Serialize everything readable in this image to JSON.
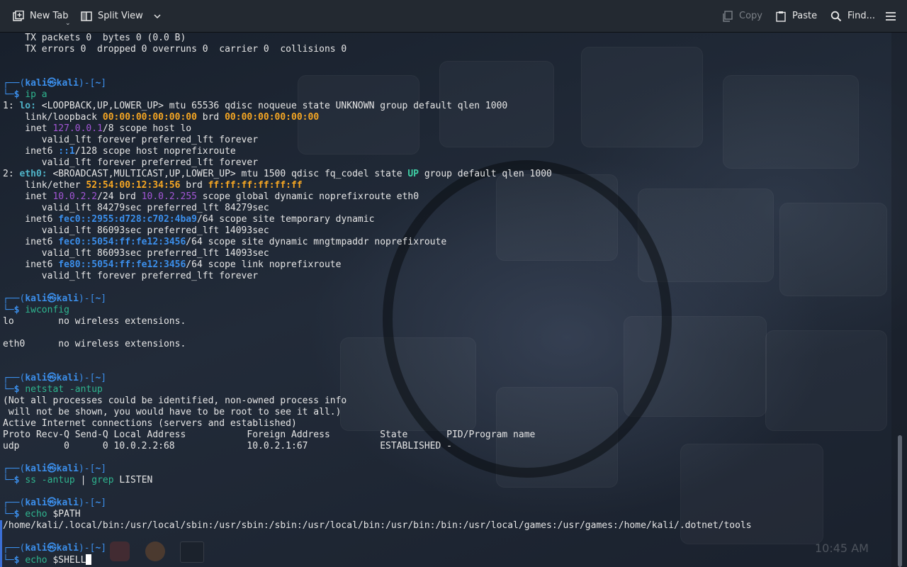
{
  "toolbar": {
    "new_tab": "New Tab",
    "split_view": "Split View",
    "copy": "Copy",
    "paste": "Paste",
    "find": "Find..."
  },
  "prompt": {
    "left": "┌──(",
    "user": "kali",
    "at": "㉿",
    "host": "kali",
    "mid": ")-[",
    "dir": "~",
    "right": "]",
    "end_prefix": "└─",
    "dollar": "$"
  },
  "terminal": {
    "l1": "    TX packets 0  bytes 0 (0.0 B)",
    "l2": "    TX errors 0  dropped 0 overruns 0  carrier 0  collisions 0",
    "cmd_ip": "ip a",
    "ip_lo_num": "1: ",
    "ip_lo_name": "lo:",
    "ip_lo_rest": " <LOOPBACK,UP,LOWER_UP> mtu 65536 qdisc noqueue state UNKNOWN group default qlen 1000",
    "lo_link_a": "    link/loopback ",
    "lo_mac": "00:00:00:00:00:00",
    "lo_brd": " brd ",
    "lo_brdmac": "00:00:00:00:00:00",
    "lo_inet_a": "    inet ",
    "lo_ip": "127.0.0.1",
    "lo_inet_b": "/8 scope host lo",
    "valid_forever": "       valid_lft forever preferred_lft forever",
    "lo_inet6_a": "    inet6 ",
    "lo_ip6": "::1",
    "lo_inet6_b": "/128 scope host noprefixroute",
    "eth_num": "2: ",
    "eth_name": "eth0:",
    "eth_rest_a": " <BROADCAST,MULTICAST,UP,LOWER_UP> mtu 1500 qdisc fq_codel state ",
    "eth_up": "UP",
    "eth_rest_b": " group default qlen 1000",
    "eth_link_a": "    link/ether ",
    "eth_mac": "52:54:00:12:34:56",
    "eth_brd": " brd ",
    "eth_brdmac": "ff:ff:ff:ff:ff:ff",
    "eth_inet_a": "    inet ",
    "eth_ip": "10.0.2.2",
    "eth_inet_b": "/24 brd ",
    "eth_bcast": "10.0.2.255",
    "eth_inet_c": " scope global dynamic noprefixroute eth0",
    "valid_84279": "       valid_lft 84279sec preferred_lft 84279sec",
    "inet6_a": "    inet6 ",
    "ip6_1": "fec0::2955:d728:c702:4ba9",
    "ip6_1_rest": "/64 scope site temporary dynamic",
    "valid_86093": "       valid_lft 86093sec preferred_lft 14093sec",
    "ip6_2": "fec0::5054:ff:fe12:3456",
    "ip6_2_rest": "/64 scope site dynamic mngtmpaddr noprefixroute",
    "ip6_3": "fe80::5054:ff:fe12:3456",
    "ip6_3_rest": "/64 scope link noprefixroute",
    "cmd_iwconfig": "iwconfig",
    "iw_lo": "lo        no wireless extensions.",
    "iw_eth0": "eth0      no wireless extensions.",
    "cmd_netstat": "netstat -antup",
    "ns1": "(Not all processes could be identified, non-owned process info",
    "ns2": " will not be shown, you would have to be root to see it all.)",
    "ns3": "Active Internet connections (servers and established)",
    "ns4": "Proto Recv-Q Send-Q Local Address           Foreign Address         State       PID/Program name",
    "ns5": "udp        0      0 10.0.2.2:68             10.0.2.1:67             ESTABLISHED -",
    "cmd_ss": "ss -antup",
    "pipe": " | ",
    "cmd_grep": "grep",
    "grep_arg": " LISTEN",
    "cmd_echo": "echo",
    "echo_path_arg": " $PATH",
    "path_out": "/home/kali/.local/bin:/usr/local/sbin:/usr/sbin:/sbin:/usr/local/bin:/usr/bin:/bin:/usr/local/games:/usr/games:/home/kali/.dotnet/tools",
    "echo_shell_arg": " $SHELL"
  },
  "colors": {
    "prompt_blue": "#3b8eea",
    "mac_orange": "#f5a623",
    "ip_purple": "#a356d6",
    "state_up": "#3fd0a5",
    "command_green": "#2fb58f"
  }
}
